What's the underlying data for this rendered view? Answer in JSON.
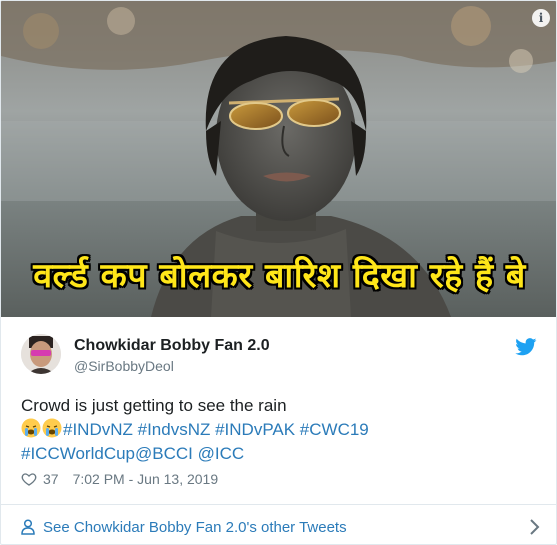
{
  "media": {
    "caption": "वर्ल्ड कप बोलकर बारिश दिखा रहे हैं बे",
    "info_icon": "info-icon",
    "info_label": "i"
  },
  "author": {
    "display_name": "Chowkidar Bobby Fan 2.0",
    "handle": "@SirBobbyDeol",
    "avatar": "avatar"
  },
  "tweet": {
    "line1": "Crowd is just getting to see the rain",
    "emojis": [
      "crying-face-icon",
      "crying-face-icon"
    ],
    "hashtags_line2": "#INDvNZ #IndvsNZ #INDvPAK #CWC19",
    "line3": "#ICCWorldCup@BCCI @ICC"
  },
  "meta": {
    "likes": "37",
    "timestamp": "7:02 PM - Jun 13, 2019"
  },
  "footer": {
    "label": "See Chowkidar Bobby Fan 2.0's other Tweets"
  },
  "colors": {
    "link": "#2b7bb9",
    "text": "#1c2022",
    "secondary": "#697882",
    "twitter_blue": "#1da1f2",
    "caption_yellow": "#ffe619"
  }
}
